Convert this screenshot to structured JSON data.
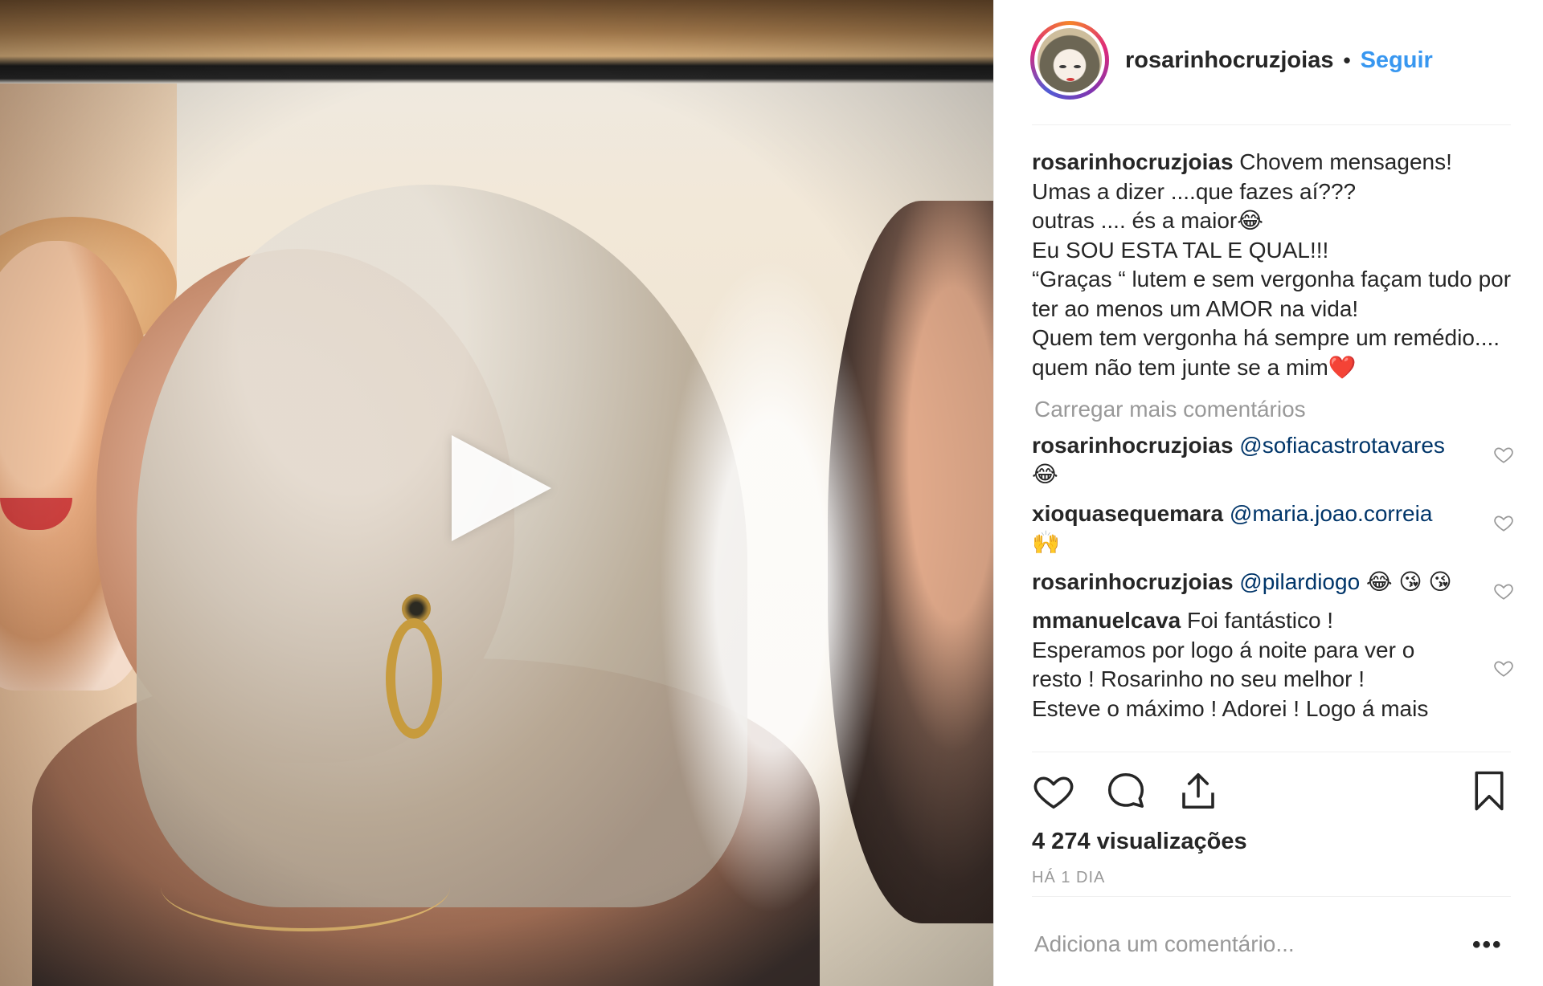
{
  "post": {
    "username": "rosarinhocruzjoias",
    "separator": "•",
    "follow_label": "Seguir"
  },
  "caption": {
    "username": "rosarinhocruzjoias",
    "text": "Chovem mensagens!\nUmas a dizer ....que fazes aí???\noutras .... és a maior😂\nEu SOU ESTA TAL E QUAL!!!\n“Graças “ lutem e sem vergonha façam tudo por ter ao menos um AMOR na vida!\nQuem tem vergonha há sempre um remédio.... quem não tem junte se a mim❤️"
  },
  "load_more": "Carregar mais comentários",
  "comments": [
    {
      "username": "rosarinhocruzjoias",
      "mention": "@sofiacastrotavares",
      "text": " 😂"
    },
    {
      "username": "xioquasequemara",
      "mention": "@maria.joao.correia",
      "text": " 🙌"
    },
    {
      "username": "rosarinhocruzjoias",
      "mention": "@pilardiogo",
      "text": " 😂 😘 😘"
    },
    {
      "username": "mmanuelcava",
      "mention": "",
      "text": "Foi fantástico !\nEsperamos por logo á noite para ver o resto ! Rosarinho no seu melhor !\nEsteve o máximo ! Adorei ! Logo á mais"
    }
  ],
  "icons": {
    "like": "heart-icon",
    "comment": "comment-bubble-icon",
    "share": "share-icon",
    "save": "bookmark-icon",
    "play": "play-icon",
    "more": "more-options-icon"
  },
  "stats": {
    "views_count": "4 274",
    "views_label": "visualizações",
    "time_ago": "HÁ 1 DIA"
  },
  "add_comment": {
    "placeholder": "Adiciona um comentário..."
  },
  "more_label": "•••",
  "colors": {
    "link": "#3897f0",
    "mention": "#003569",
    "muted": "#999999",
    "text": "#262626"
  }
}
